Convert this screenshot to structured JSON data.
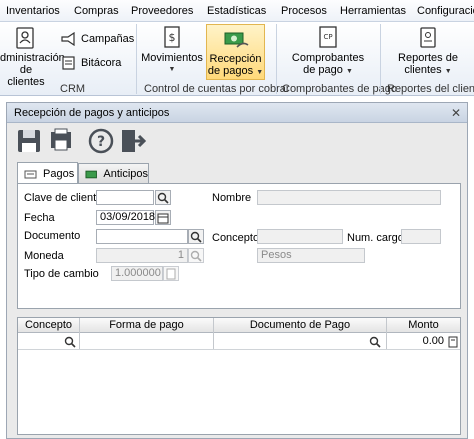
{
  "menu": [
    "Inventarios",
    "Compras",
    "Proveedores",
    "Estadísticas",
    "Procesos",
    "Herramientas",
    "Configuración"
  ],
  "ribbon": {
    "crm": {
      "admin_label_1": "dministración",
      "admin_label_2": "de clientes",
      "campanas": "Campañas",
      "bitacora": "Bitácora",
      "group": "CRM"
    },
    "cobrar": {
      "movimientos": "Movimientos",
      "recepcion_1": "Recepción",
      "recepcion_2": "de pagos",
      "group": "Control de cuentas por cobrar"
    },
    "comprobantes": {
      "label_1": "Comprobantes",
      "label_2": "de pago",
      "group": "Comprobantes de pago"
    },
    "reportes": {
      "label_1": "Reportes de",
      "label_2": "clientes",
      "group": "Reportes del cliente"
    }
  },
  "dialog": {
    "title": "Recepción de pagos y anticipos",
    "close": "✕",
    "tabs": [
      "Pagos",
      "Anticipos"
    ],
    "form": {
      "clave_label": "Clave de cliente",
      "clave_value": "",
      "nombre_label": "Nombre",
      "nombre_value": "",
      "fecha_label": "Fecha",
      "fecha_value": "03/09/2018",
      "documento_label": "Documento",
      "documento_value": "",
      "concepto_label": "Concepto",
      "concepto_value": "",
      "numcargo_label": "Num. cargo",
      "numcargo_value": "",
      "moneda_label": "Moneda",
      "moneda_value": "1",
      "moneda_name": "Pesos",
      "tipocambio_label": "Tipo de cambio",
      "tipocambio_value": "1.000000"
    },
    "grid": {
      "columns": [
        "Concepto",
        "Forma de pago",
        "Documento de Pago",
        "Monto"
      ],
      "rows": [
        {
          "concepto": "",
          "forma": "",
          "documento": "",
          "monto": "0.00"
        }
      ]
    }
  }
}
